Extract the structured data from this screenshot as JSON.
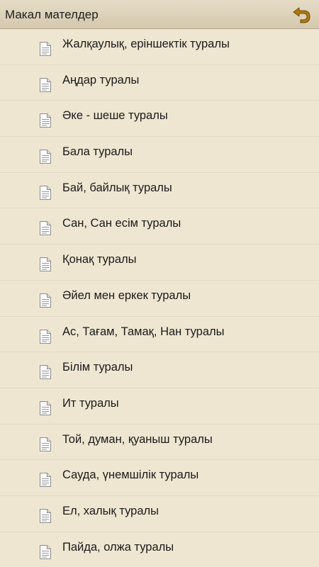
{
  "header": {
    "title": "Макал мателдер",
    "back_icon": "back-arrow-icon",
    "accent_color": "#b07a10"
  },
  "list": {
    "item_icon": "document-icon",
    "items": [
      {
        "label": "Жалқаулық, еріншектік туралы"
      },
      {
        "label": "Аңдар туралы"
      },
      {
        "label": "Әке - шеше туралы"
      },
      {
        "label": "Бала туралы"
      },
      {
        "label": "Бай, байлық туралы"
      },
      {
        "label": "Сан, Сан есім туралы"
      },
      {
        "label": "Қонақ туралы"
      },
      {
        "label": "Әйел мен еркек туралы"
      },
      {
        "label": "Ас, Тағам, Тамақ, Нан туралы"
      },
      {
        "label": "Білім туралы"
      },
      {
        "label": "Ит туралы"
      },
      {
        "label": "Той, думан, қуаныш туралы"
      },
      {
        "label": "Сауда, үнемшілік туралы"
      },
      {
        "label": "Ел, халық туралы"
      },
      {
        "label": "Пайда, олжа туралы"
      }
    ]
  }
}
